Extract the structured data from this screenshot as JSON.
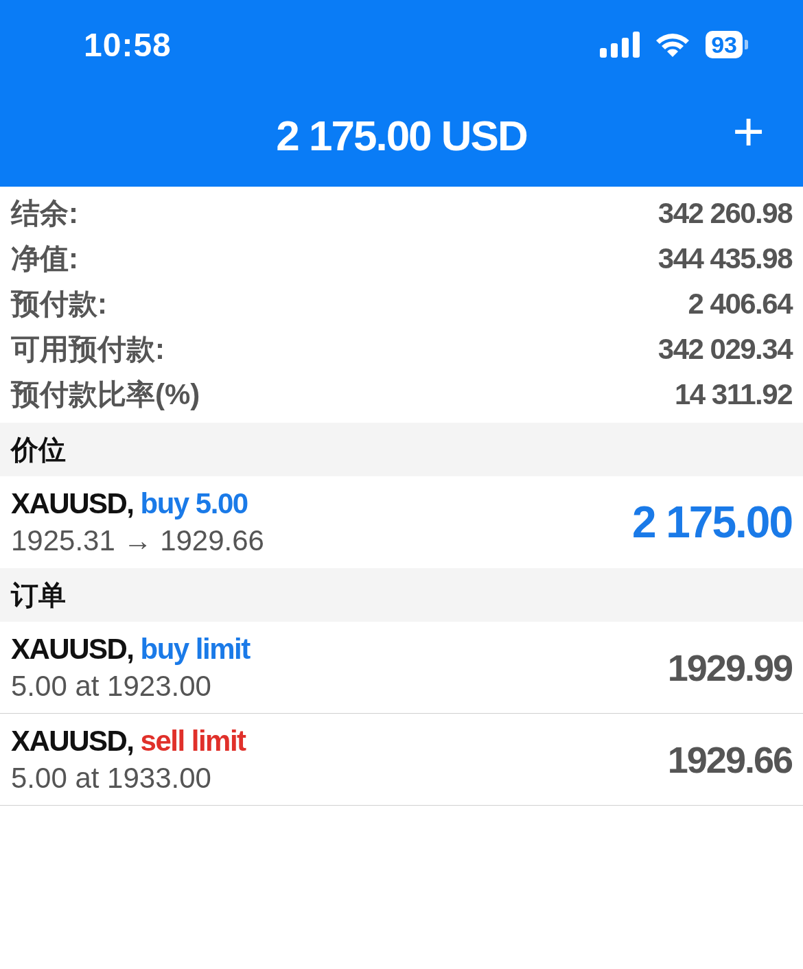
{
  "status_bar": {
    "time": "10:58",
    "battery": "93"
  },
  "header": {
    "title": "2 175.00 USD",
    "add_icon": "+"
  },
  "summary": [
    {
      "label": "结余:",
      "value": "342 260.98"
    },
    {
      "label": "净值:",
      "value": "344 435.98"
    },
    {
      "label": "预付款:",
      "value": "2 406.64"
    },
    {
      "label": "可用预付款:",
      "value": "342 029.34"
    },
    {
      "label": "预付款比率(%)",
      "value": "14 311.92"
    }
  ],
  "positions": {
    "title": "价位",
    "items": [
      {
        "symbol": "XAUUSD,",
        "kind": "buy",
        "action": "buy 5.00",
        "detail": "1925.31 → 1929.66",
        "value": "2 175.00"
      }
    ]
  },
  "orders": {
    "title": "订单",
    "items": [
      {
        "symbol": "XAUUSD,",
        "kind": "buy",
        "action": "buy limit",
        "detail": "5.00 at 1923.00",
        "value": "1929.99"
      },
      {
        "symbol": "XAUUSD,",
        "kind": "sell",
        "action": "sell limit",
        "detail": "5.00 at 1933.00",
        "value": "1929.66"
      }
    ]
  }
}
